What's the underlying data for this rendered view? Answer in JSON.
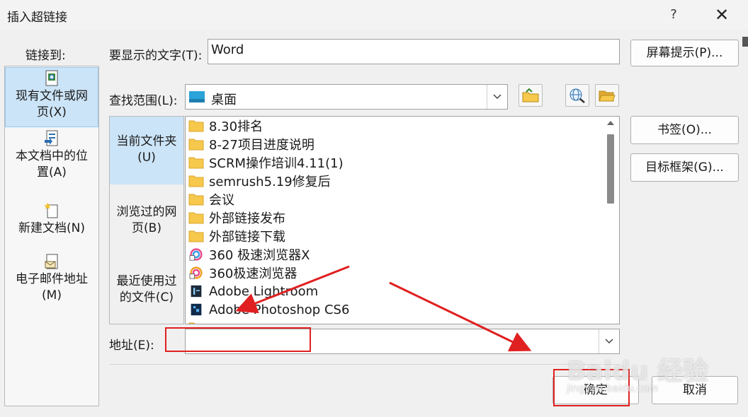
{
  "window": {
    "title": "插入超链接",
    "help_label": "?",
    "close_label": "✕"
  },
  "link_to": {
    "label": "链接到:",
    "items": [
      {
        "label": "现有文件或网页(X)",
        "icon": "existing-file-icon",
        "selected": true
      },
      {
        "label": "本文档中的位置(A)",
        "icon": "place-in-document-icon",
        "selected": false
      },
      {
        "label": "新建文档(N)",
        "icon": "new-document-icon",
        "selected": false
      },
      {
        "label": "电子邮件地址(M)",
        "icon": "email-address-icon",
        "selected": false
      }
    ]
  },
  "display_text": {
    "label": "要显示的文字(T):",
    "value": "Word"
  },
  "screentip_button": "屏幕提示(P)...",
  "look_in": {
    "label": "查找范围(L):",
    "value": "桌面"
  },
  "browse": {
    "items": [
      {
        "label": "当前文件夹(U)",
        "selected": true
      },
      {
        "label": "浏览过的网页(B)",
        "selected": false
      },
      {
        "label": "最近使用过的文件(C)",
        "selected": false
      }
    ]
  },
  "files": [
    {
      "name": "8.30排名",
      "icon": "folder-icon"
    },
    {
      "name": "8-27项目进度说明",
      "icon": "folder-icon"
    },
    {
      "name": "SCRM操作培训4.11(1)",
      "icon": "folder-icon"
    },
    {
      "name": "semrush5.19修复后",
      "icon": "folder-icon"
    },
    {
      "name": "会议",
      "icon": "folder-icon"
    },
    {
      "name": "外部链接发布",
      "icon": "folder-icon"
    },
    {
      "name": "外部链接下载",
      "icon": "folder-icon"
    },
    {
      "name": "360 极速浏览器X",
      "icon": "browser-shortcut-icon"
    },
    {
      "name": "360极速浏览器",
      "icon": "browser-shortcut-icon"
    },
    {
      "name": "Adobe Lightroom",
      "icon": "lightroom-shortcut-icon"
    },
    {
      "name": "Adobe Photoshop CS6",
      "icon": "photoshop-shortcut-icon"
    }
  ],
  "right_buttons": {
    "bookmark": "书签(O)...",
    "target_frame": "目标框架(G)..."
  },
  "address": {
    "label": "地址(E):",
    "value": ""
  },
  "footer": {
    "ok": "确定",
    "cancel": "取消"
  },
  "watermark": {
    "text": "Baidu 经验",
    "sub": "jingyan.baidu.com"
  },
  "colors": {
    "selection": "#cce4f7",
    "annotation_red": "#e02020",
    "folder_yellow": "#f6c84c"
  }
}
